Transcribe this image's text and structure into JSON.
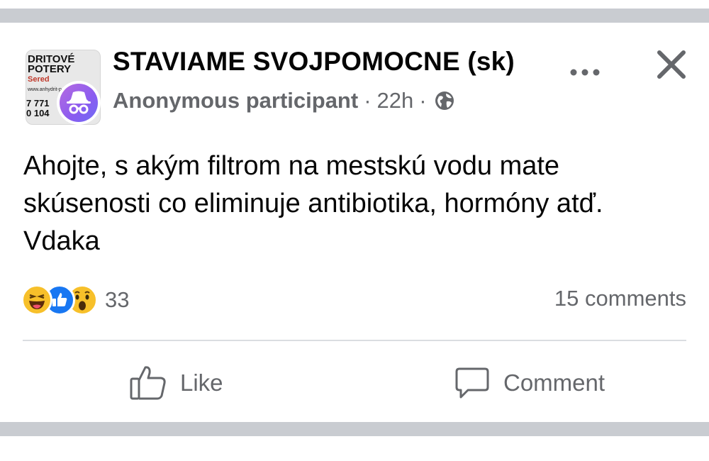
{
  "post": {
    "group_name": "STAVIAME SVOJPOMOCNE (sk)",
    "author": "Anonymous participant",
    "separator": "·",
    "time": "22h",
    "privacy_icon": "globe-icon",
    "more_icon": "more-horizontal-icon",
    "close_icon": "close-icon",
    "group_avatar": {
      "logo_line1": "DRITOVÉ",
      "logo_line2": "POTERY",
      "logo_line3": "Sered",
      "logo_url": "www.anhydrit-p",
      "logo_phone1": "7 771",
      "logo_phone2": "0 104"
    },
    "text_lines": [
      "Ahojte, s akým filtrom na mestskú vodu mate",
      "skúsenosti co eliminuje antibiotika, hormóny atď.",
      "Vdaka"
    ],
    "reactions": {
      "icons": [
        "haha-reaction-icon",
        "like-reaction-icon",
        "wow-reaction-icon"
      ],
      "count": "33"
    },
    "comments_count": "15 comments",
    "actions": {
      "like_label": "Like",
      "comment_label": "Comment"
    }
  },
  "colors": {
    "divider_band": "#c9ccd1",
    "secondary_text": "#65676b",
    "primary_text": "#050505",
    "like_blue": "#1877f2"
  }
}
